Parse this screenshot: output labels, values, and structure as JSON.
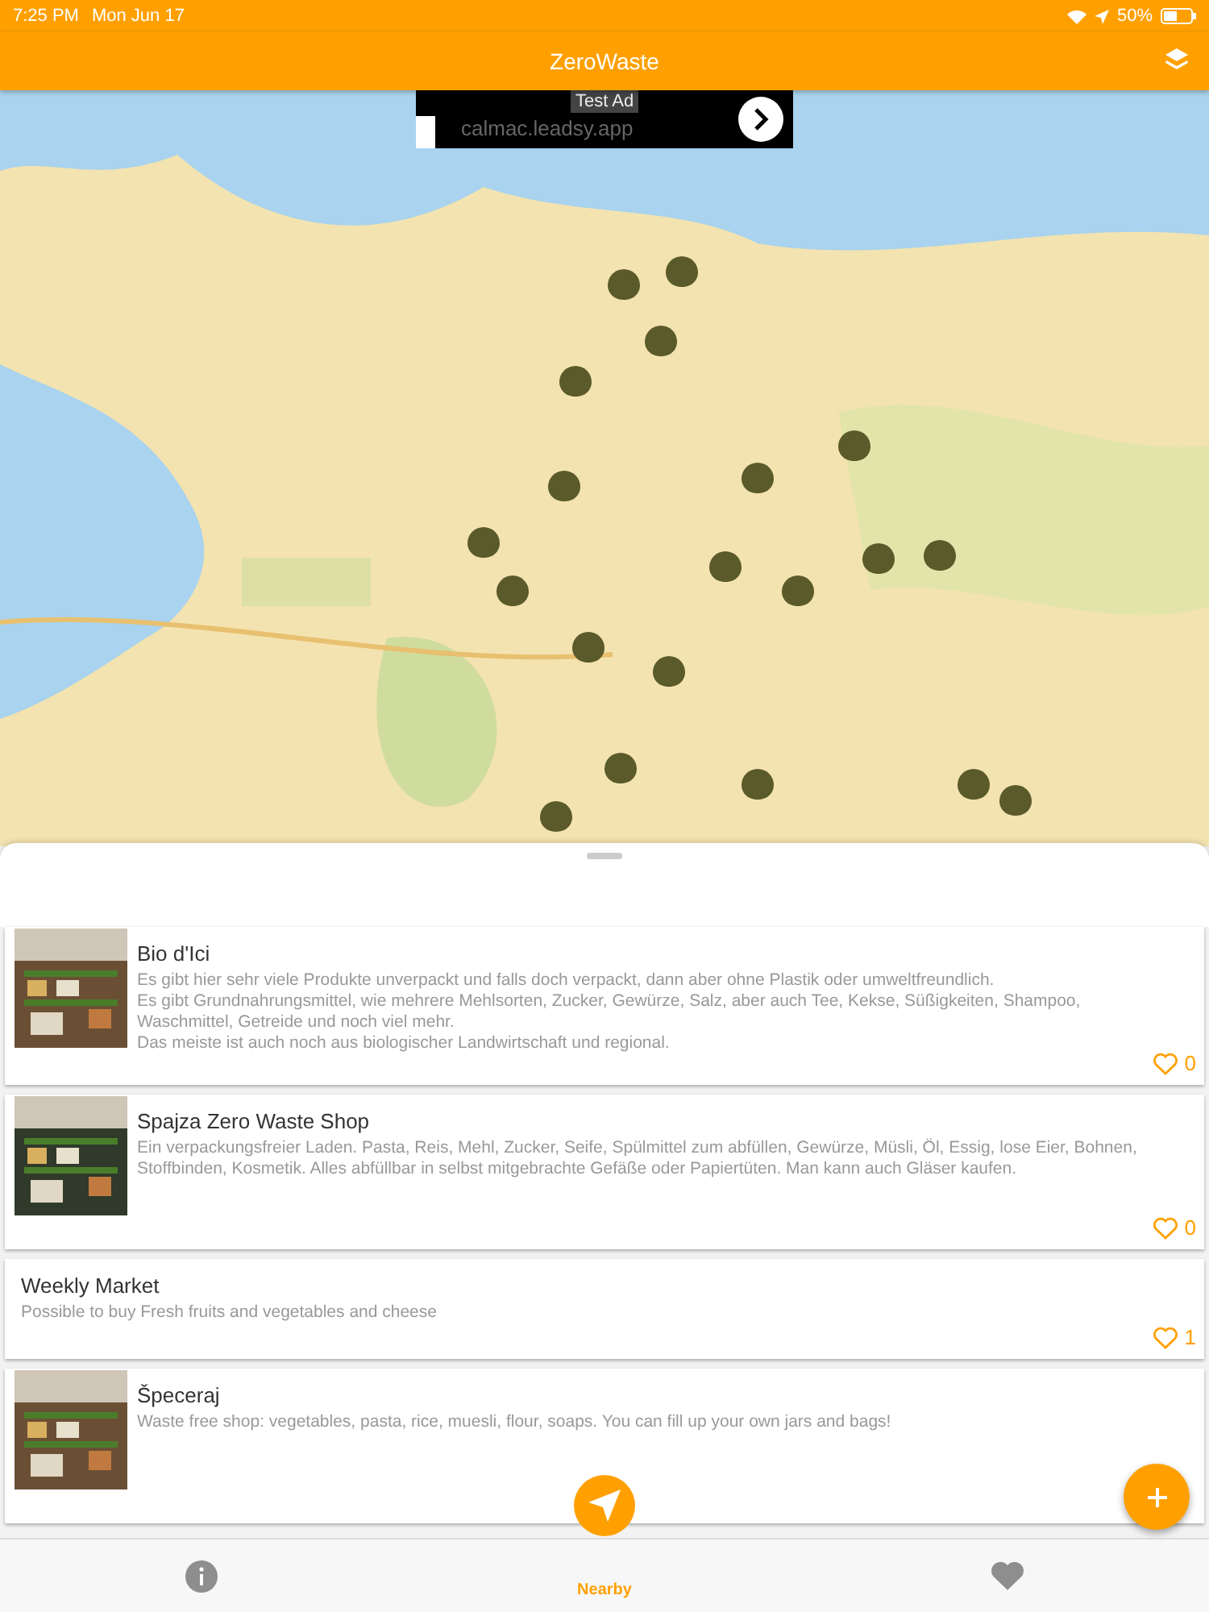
{
  "status_bar": {
    "time": "7:25 PM",
    "date": "Mon Jun 17",
    "battery": "50%"
  },
  "nav_bar": {
    "title": "ZeroWaste"
  },
  "map": {
    "kind": "picture",
    "ad": {
      "badge": "Test Ad",
      "url": "calmac.leadsy.app"
    }
  },
  "places": [
    {
      "name": "Bio d'Ici",
      "has_photo": true,
      "description": "Es gibt hier sehr viele Produkte unverpackt und falls doch verpackt, dann aber ohne Plastik oder umweltfreundlich.\nEs gibt Grundnahrungsmittel, wie mehrere Mehlsorten, Zucker, Gewürze, Salz, aber auch Tee, Kekse, Süßigkeiten, Shampoo, Waschmittel, Getreide und noch viel mehr.\nDas meiste ist auch noch aus biologischer Landwirtschaft und regional.",
      "likes": "0"
    },
    {
      "name": "Spajza Zero Waste Shop",
      "has_photo": true,
      "description": "Ein verpackungsfreier Laden. Pasta, Reis, Mehl, Zucker, Seife, Spülmittel zum abfüllen, Gewürze, Müsli, Öl, Essig, lose Eier, Bohnen, Stoffbinden, Kosmetik. Alles abfüllbar in selbst mitgebrachte Gefäße oder Papiertüten. Man kann auch Gläser kaufen.",
      "likes": "0"
    },
    {
      "name": "Weekly Market",
      "has_photo": false,
      "description": "Possible to buy Fresh fruits and vegetables and cheese",
      "likes": "1"
    },
    {
      "name": "Špeceraj",
      "has_photo": true,
      "description": "Waste free shop: vegetables, pasta, rice, muesli, flour, soaps. You can fill up your own jars and bags!"
    }
  ],
  "tabs": [
    {
      "kind": "info",
      "selected": false
    },
    {
      "kind": "nearby",
      "label": "Nearby",
      "selected": true
    },
    {
      "kind": "favorites",
      "selected": false
    }
  ]
}
